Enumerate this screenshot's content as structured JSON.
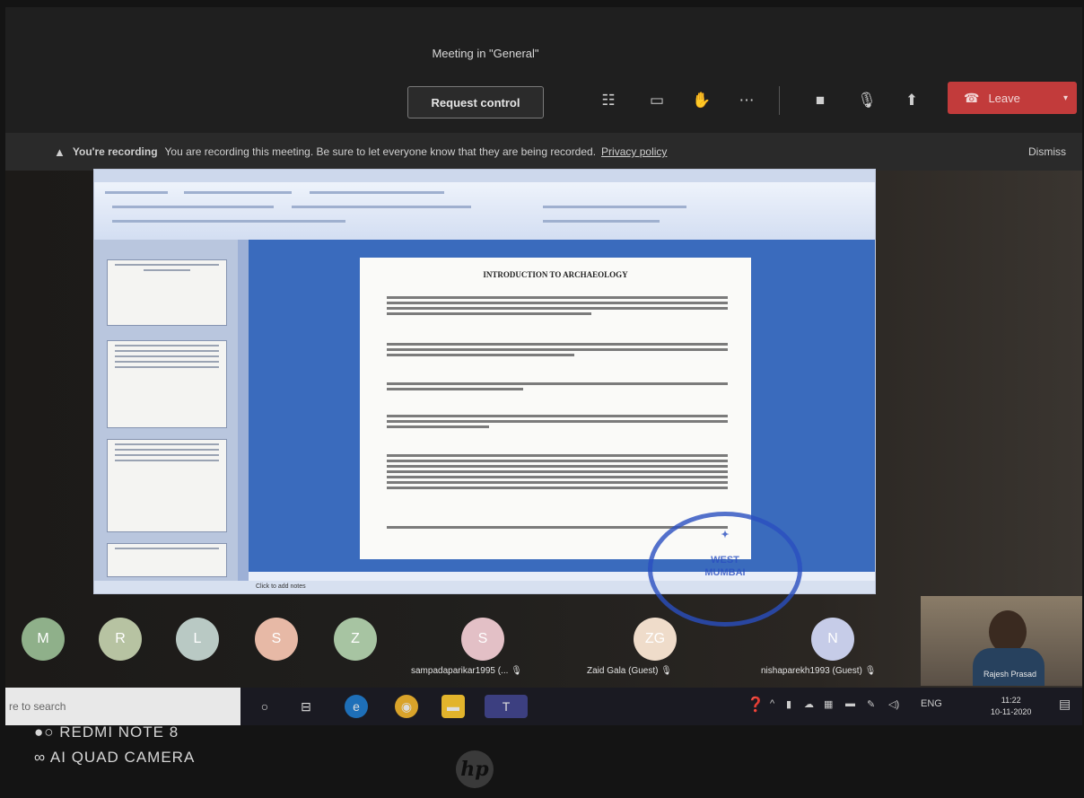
{
  "window": {
    "title": "Meeting in \"General\""
  },
  "toolbar": {
    "request_control_label": "Request control",
    "leave_label": "Leave"
  },
  "recording_banner": {
    "prefix": "You're recording",
    "message": "You are recording this meeting. Be sure to let everyone know that they are being recorded.",
    "link": "Privacy policy",
    "dismiss": "Dismiss"
  },
  "shared_document": {
    "heading": "INTRODUCTION TO ARCHAEOLOGY",
    "statusbar": "Click to add notes"
  },
  "stamp": {
    "line1": "WEST",
    "line2": "MUMBAI"
  },
  "participants": [
    {
      "initials": "M",
      "color": "#8fb08a"
    },
    {
      "initials": "R",
      "color": "#b7c3a2"
    },
    {
      "initials": "L",
      "color": "#b9c9c4"
    },
    {
      "initials": "S",
      "color": "#e7b9a6"
    },
    {
      "initials": "Z",
      "color": "#a7c4a2"
    }
  ],
  "named_participants": [
    {
      "initials": "S",
      "name": "sampadaparikar1995 (...",
      "color": "#e3c0c6"
    },
    {
      "initials": "ZG",
      "name": "Zaid Gala (Guest)",
      "color": "#efdcca"
    },
    {
      "initials": "N",
      "name": "nishaparekh1993 (Guest)",
      "color": "#c6cce8"
    }
  ],
  "self_video": {
    "name": "Rajesh Prasad"
  },
  "taskbar": {
    "search_placeholder": "re to search",
    "language": "ENG",
    "time": "11:22",
    "date": "10-11-2020"
  },
  "bezel": {
    "camera_line1": "REDMI NOTE 8",
    "camera_line2": "AI QUAD CAMERA"
  }
}
